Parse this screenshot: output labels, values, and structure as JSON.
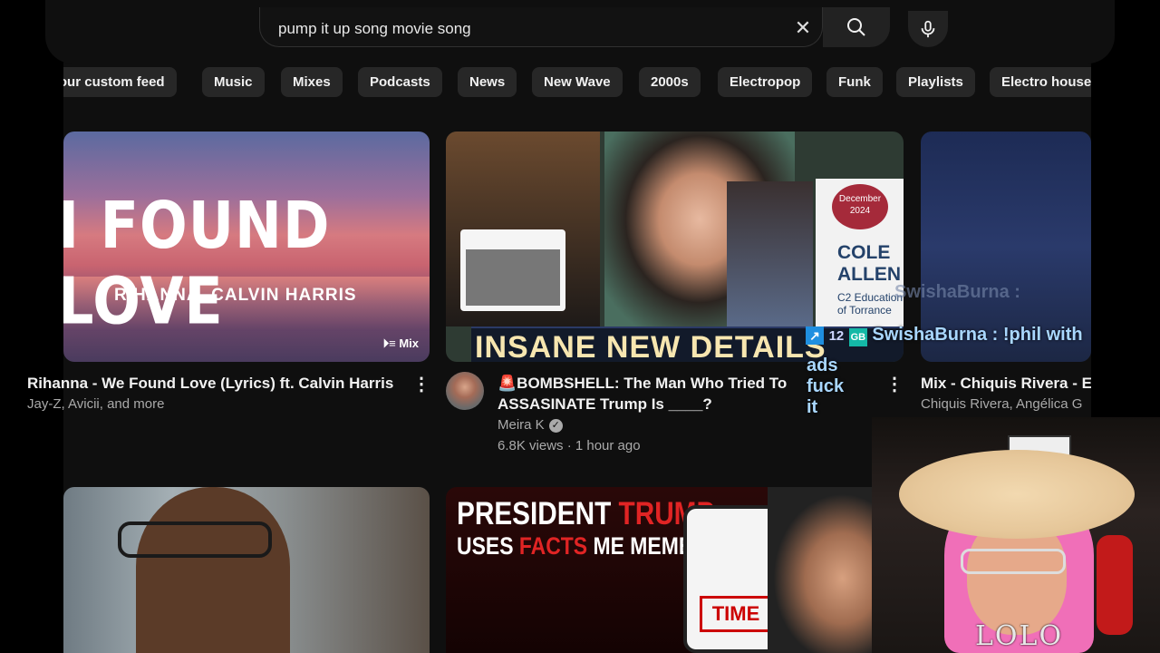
{
  "search": {
    "query": "pump it up song movie song",
    "clear_icon": "✕"
  },
  "chips": [
    {
      "label": "Your custom feed"
    },
    {
      "label": "Music"
    },
    {
      "label": "Mixes"
    },
    {
      "label": "Podcasts"
    },
    {
      "label": "News"
    },
    {
      "label": "New Wave"
    },
    {
      "label": "2000s"
    },
    {
      "label": "Electropop"
    },
    {
      "label": "Funk"
    },
    {
      "label": "Playlists"
    },
    {
      "label": "Electro house"
    }
  ],
  "videos": [
    {
      "thumb_big_text": "I FOUND LOVE",
      "thumb_small_text": "RIHANNA, CALVIN HARRIS",
      "badge": "Mix",
      "title": "Rihanna - We Found Love (Lyrics) ft. Calvin Harris",
      "subtitle": "Jay-Z, Avicii, and more"
    },
    {
      "thumb_banner": "INSANE NEW DETAILS",
      "thumb_seal": "December 2024",
      "thumb_card_name": "COLE ALLEN",
      "thumb_card_sub": "C2 Education of Torrance",
      "title": "🚨BOMBSHELL: The Man Who Tried To ASSASINATE Trump Is ____?",
      "channel": "Meira K",
      "stats": "6.8K views · 1 hour ago"
    },
    {
      "title": "Mix - Chiquis Rivera - E",
      "subtitle": "Chiquis Rivera, Angélica G"
    },
    {
      "thumb_line1_a": "PRESIDENT ",
      "thumb_line1_b": "TRUMP",
      "thumb_line2_a": "USES ",
      "thumb_line2_b": "FACTS",
      "thumb_line2_c": " ME MEME!",
      "thumb_phone_text": "TIME"
    }
  ],
  "chat": {
    "count": "12",
    "ghost_text": "SwishaBurna :",
    "username": "SwishaBurna",
    "message": " : !phil with",
    "message_line2": "ads fuck it"
  },
  "overlay": {
    "watermark": "LOLO"
  }
}
